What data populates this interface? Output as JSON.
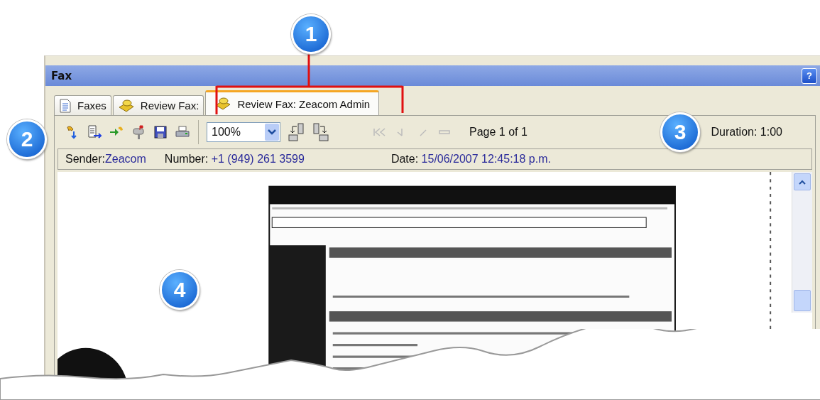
{
  "callouts": [
    {
      "label": "1"
    },
    {
      "label": "2"
    },
    {
      "label": "3"
    },
    {
      "label": "4"
    }
  ],
  "window": {
    "title": "Fax",
    "help_button": "?"
  },
  "tabs": [
    {
      "label": "Faxes",
      "kind": "document",
      "selected": false
    },
    {
      "label": "Review Fax:",
      "kind": "fax",
      "selected": false
    },
    {
      "label": "Review Fax: Zeacom Admin",
      "kind": "fax",
      "selected": true
    }
  ],
  "toolbar": {
    "zoom": "100%",
    "navigation_disabled": true,
    "page": "Page 1 of 1",
    "duration": "Duration: 1:00"
  },
  "info": {
    "sender_label": "Sender:",
    "sender": "Zeacom",
    "number_label": "Number:",
    "number": "+1 (949) 261 3599",
    "date_label": "Date:",
    "date": "15/06/2007 12:45:18 p.m."
  }
}
